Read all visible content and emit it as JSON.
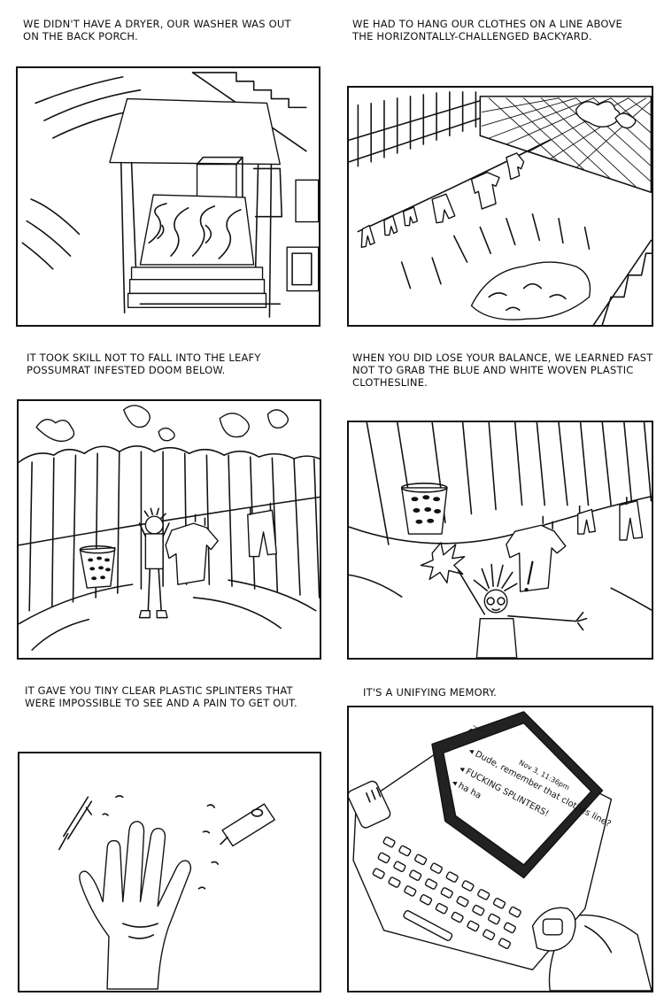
{
  "panels": [
    {
      "caption": "We didn't have a dryer, our washer was out on the back porch."
    },
    {
      "caption": "We had to hang our clothes on a line above the horizontally-challenged backyard."
    },
    {
      "caption": "It took skill not to fall into the leafy possumrat infested doom below."
    },
    {
      "caption": "When you did lose your balance, we learned fast not to grab the blue and white woven plastic clothesline."
    },
    {
      "caption": "It gave you tiny clear plastic splinters that were impossible to see and a pain to get out."
    },
    {
      "caption": "It's a unifying memory."
    }
  ],
  "phone": {
    "header_date": "Nov 3, 11:36pm",
    "messages": [
      "Dude, remember that clothes line?",
      "FUCKING SPLINTERS!",
      "ha ha"
    ]
  },
  "colors": {
    "ink": "#111111",
    "paper": "#ffffff"
  }
}
